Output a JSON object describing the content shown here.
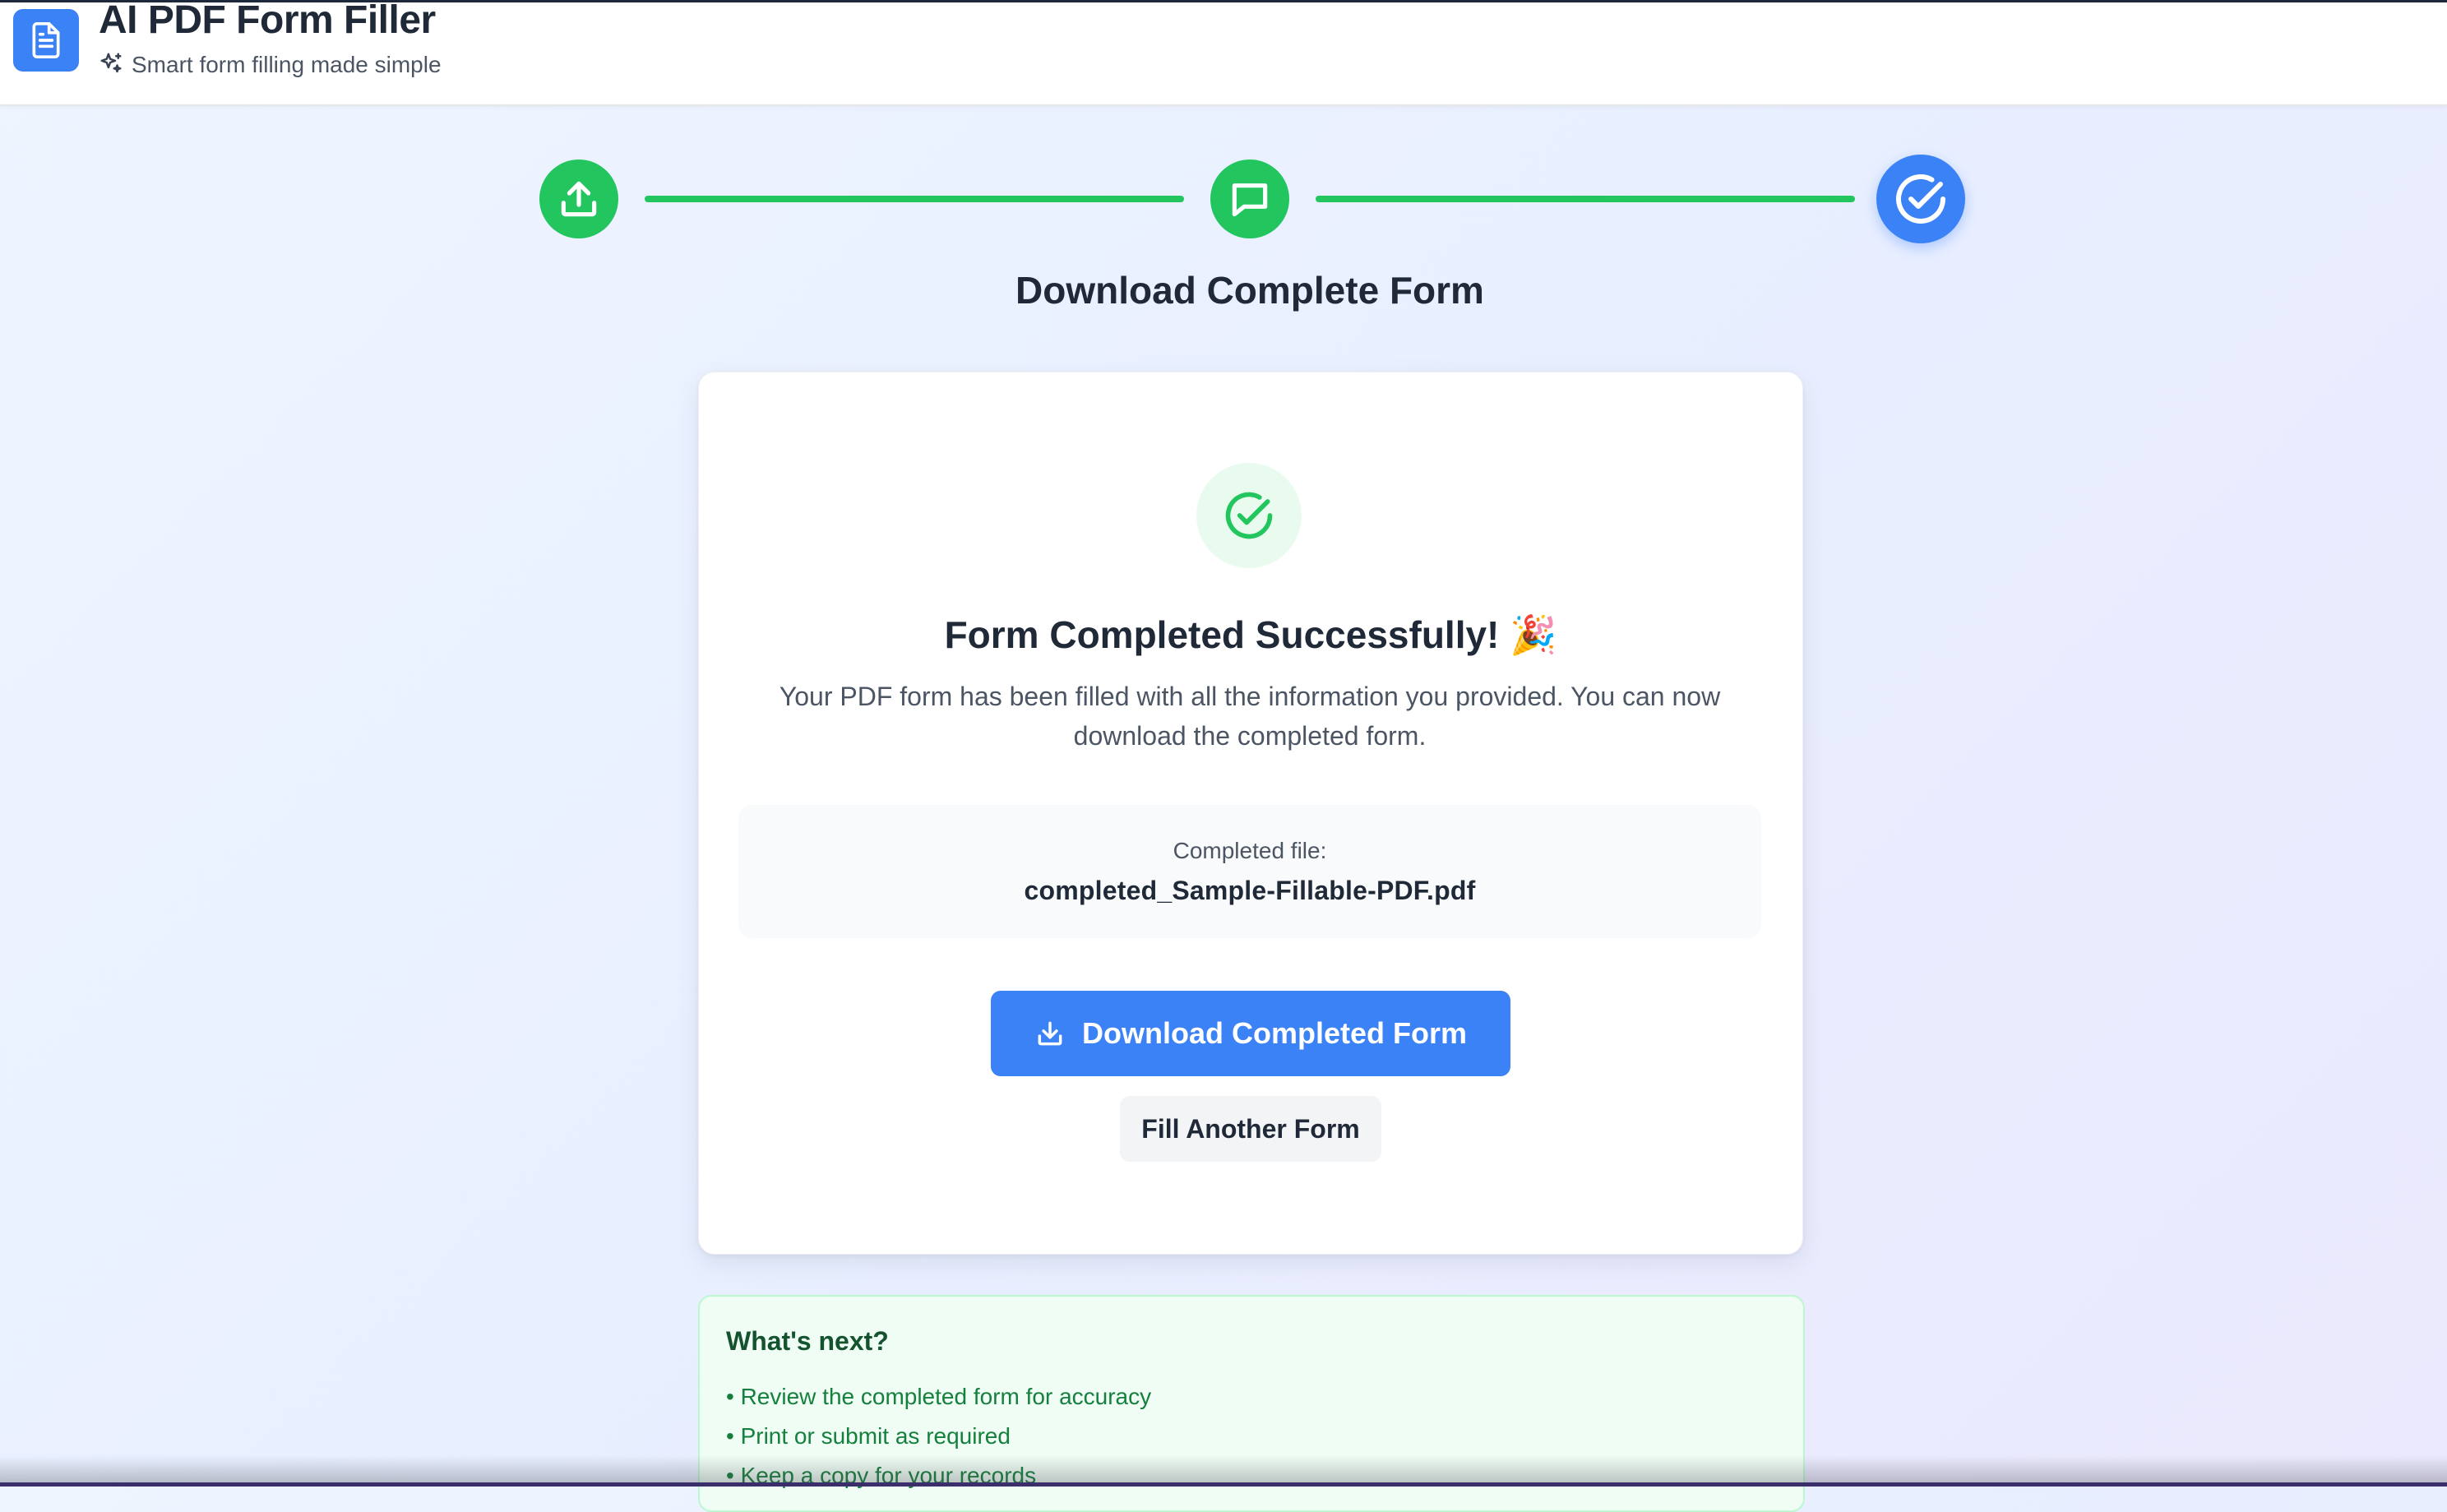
{
  "header": {
    "app_title": "AI PDF Form Filler",
    "app_subtitle": "Smart form filling made simple",
    "logo_icon": "document-icon",
    "subtitle_icon": "sparkles-icon"
  },
  "stepper": {
    "steps": [
      {
        "icon": "upload-icon",
        "status": "complete"
      },
      {
        "icon": "chat-icon",
        "status": "complete"
      },
      {
        "icon": "check-circle-icon",
        "status": "current"
      }
    ],
    "current_title": "Download Complete Form"
  },
  "card": {
    "title": "Form Completed Successfully! 🎉",
    "description": "Your PDF form has been filled with all the information you provided. You can now download the completed form.",
    "file_label": "Completed file:",
    "file_name": "completed_Sample-Fillable-PDF.pdf",
    "download_button": "Download Completed Form",
    "fill_another_button": "Fill Another Form"
  },
  "next": {
    "title": "What's next?",
    "items": [
      "• Review the completed form for accuracy",
      "• Print or submit as required",
      "• Keep a copy for your records"
    ]
  },
  "colors": {
    "accent_blue": "#3b82f6",
    "success_green": "#22c55e",
    "next_text_green": "#15803d"
  }
}
